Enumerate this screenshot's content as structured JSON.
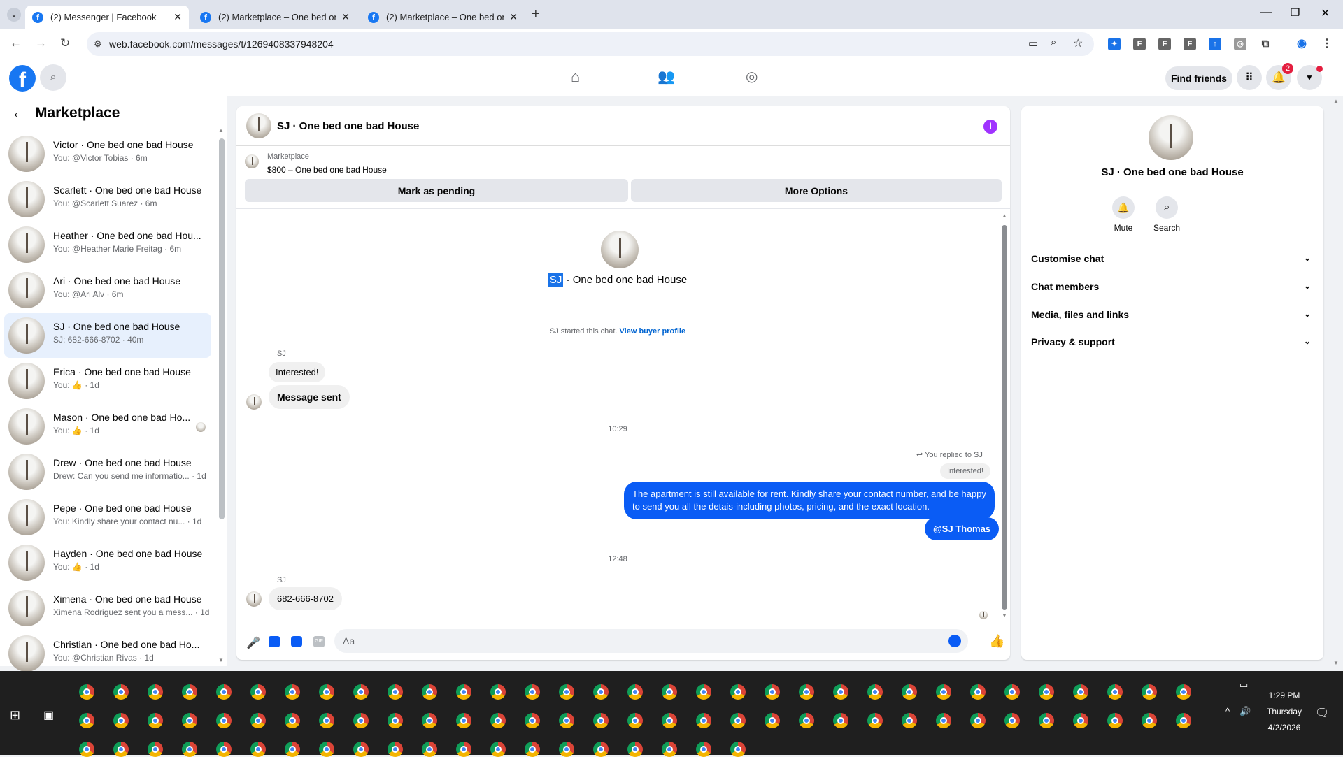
{
  "browser": {
    "tabs": [
      {
        "title": "(2) Messenger | Facebook"
      },
      {
        "title": "(2) Marketplace – One bed one"
      },
      {
        "title": "(2) Marketplace – One bed one"
      }
    ],
    "url": "web.facebook.com/messages/t/1269408337948204"
  },
  "fbnav": {
    "find_friends": "Find friends",
    "notif_count": "2"
  },
  "sidebar": {
    "title": "Marketplace",
    "conversations": [
      {
        "name": "Victor · One bed one bad House",
        "meta": "You: @Victor Tobias · 6m"
      },
      {
        "name": "Scarlett · One bed one bad House",
        "meta": "You: @Scarlett Suarez · 6m"
      },
      {
        "name": "Heather · One bed one bad Hou...",
        "meta": "You: @Heather Marie Freitag · 6m"
      },
      {
        "name": "Ari · One bed one bad House",
        "meta": "You: @Ari Alv · 6m"
      },
      {
        "name": "SJ · One bed one bad House",
        "meta": "SJ: 682-666-8702 · 40m"
      },
      {
        "name": "Erica · One bed one bad House",
        "meta": "You: 👍 · 1d"
      },
      {
        "name": "Mason · One bed one bad Ho...",
        "meta": "You: 👍 · 1d"
      },
      {
        "name": "Drew · One bed one bad House",
        "meta": "Drew: Can you send me informatio... · 1d"
      },
      {
        "name": "Pepe · One bed one bad House",
        "meta": "You: Kindly share your contact nu... · 1d"
      },
      {
        "name": "Hayden · One bed one bad House",
        "meta": "You: 👍 · 1d"
      },
      {
        "name": "Ximena · One bed one bad House",
        "meta": "Ximena Rodriguez sent you a mess... · 1d"
      },
      {
        "name": "Christian · One bed one bad Ho...",
        "meta": "You: @Christian Rivas · 1d"
      }
    ]
  },
  "chat": {
    "header_title": "SJ · One bed one bad House",
    "listing_label": "Marketplace",
    "listing_price": "$800 – One bed one bad House",
    "mark_pending": "Mark as pending",
    "more_options": "More Options",
    "intro_sj": "SJ",
    "intro_title": "· One bed one bad House",
    "started_text": "SJ started this chat.",
    "view_profile": "View buyer profile",
    "sender1": "SJ",
    "msg_interested": "Interested!",
    "msg_sent": "Message sent",
    "time1": "10:29",
    "replied_to": "You replied to SJ",
    "quoted": "Interested!",
    "my_msg": "The apartment is still available for rent. Kindly share your contact number, and be happy to send you all the detais-including photos, pricing, and the exact location.",
    "mention": "@SJ Thomas",
    "time2": "12:48",
    "sender2": "SJ",
    "phone_msg": "682-666-8702",
    "input_placeholder": "Aa"
  },
  "details": {
    "title": "SJ · One bed one bad House",
    "mute": "Mute",
    "search": "Search",
    "sections": [
      "Customise chat",
      "Chat members",
      "Media, files and links",
      "Privacy & support"
    ]
  },
  "taskbar": {
    "time": "1:29 PM",
    "day": "Thursday",
    "date": "4/2/2026"
  },
  "colors": {
    "accent": "#0a5cf5",
    "fb_blue": "#1877f2",
    "badge": "#e41e3f"
  }
}
